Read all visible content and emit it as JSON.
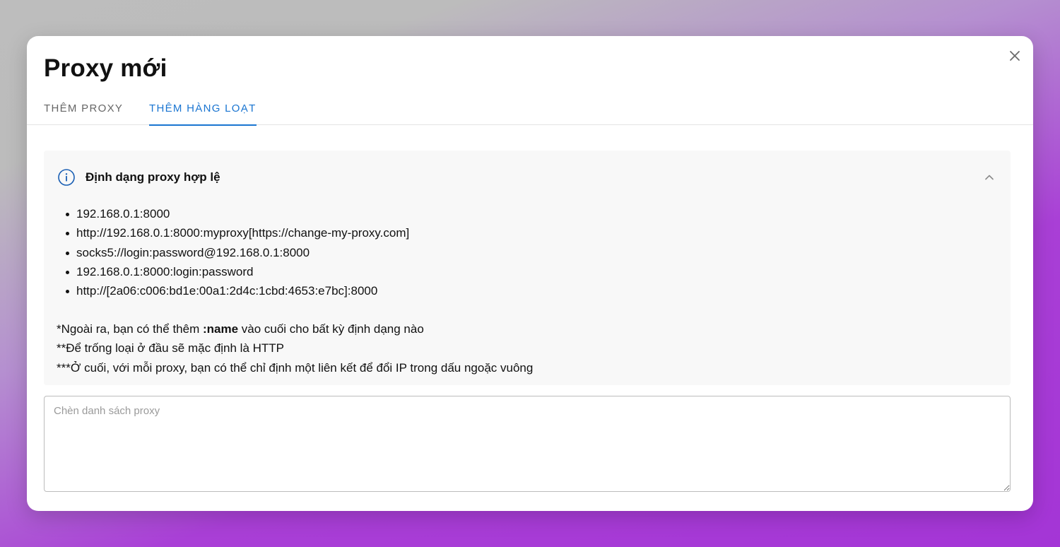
{
  "dialog": {
    "title": "Proxy mới",
    "tabs": [
      {
        "label": "THÊM PROXY",
        "active": false
      },
      {
        "label": "THÊM HÀNG LOẠT",
        "active": true
      }
    ]
  },
  "info": {
    "title": "Định dạng proxy hợp lệ",
    "formats": [
      "192.168.0.1:8000",
      "http://192.168.0.1:8000:myproxy[https://change-my-proxy.com]",
      "socks5://login:password@192.168.0.1:8000",
      "192.168.0.1:8000:login:password",
      "http://[2a06:c006:bd1e:00a1:2d4c:1cbd:4653:e7bc]:8000"
    ],
    "notes": {
      "note1_prefix": "*Ngoài ra, bạn có thể thêm ",
      "note1_bold": ":name",
      "note1_suffix": " vào cuối cho bất kỳ định dạng nào",
      "note2": "**Để trống loại ở đầu sẽ mặc định là HTTP",
      "note3": "***Ở cuối, với mỗi proxy, bạn có thể chỉ định một liên kết để đổi IP trong dấu ngoặc vuông"
    }
  },
  "input": {
    "placeholder": "Chèn danh sách proxy",
    "value": ""
  },
  "icons": {
    "close": "close-icon",
    "info": "info-icon",
    "collapse": "chevron-up-icon"
  },
  "colors": {
    "accent": "#1a75d1",
    "panel_bg": "#f8f8f8"
  }
}
